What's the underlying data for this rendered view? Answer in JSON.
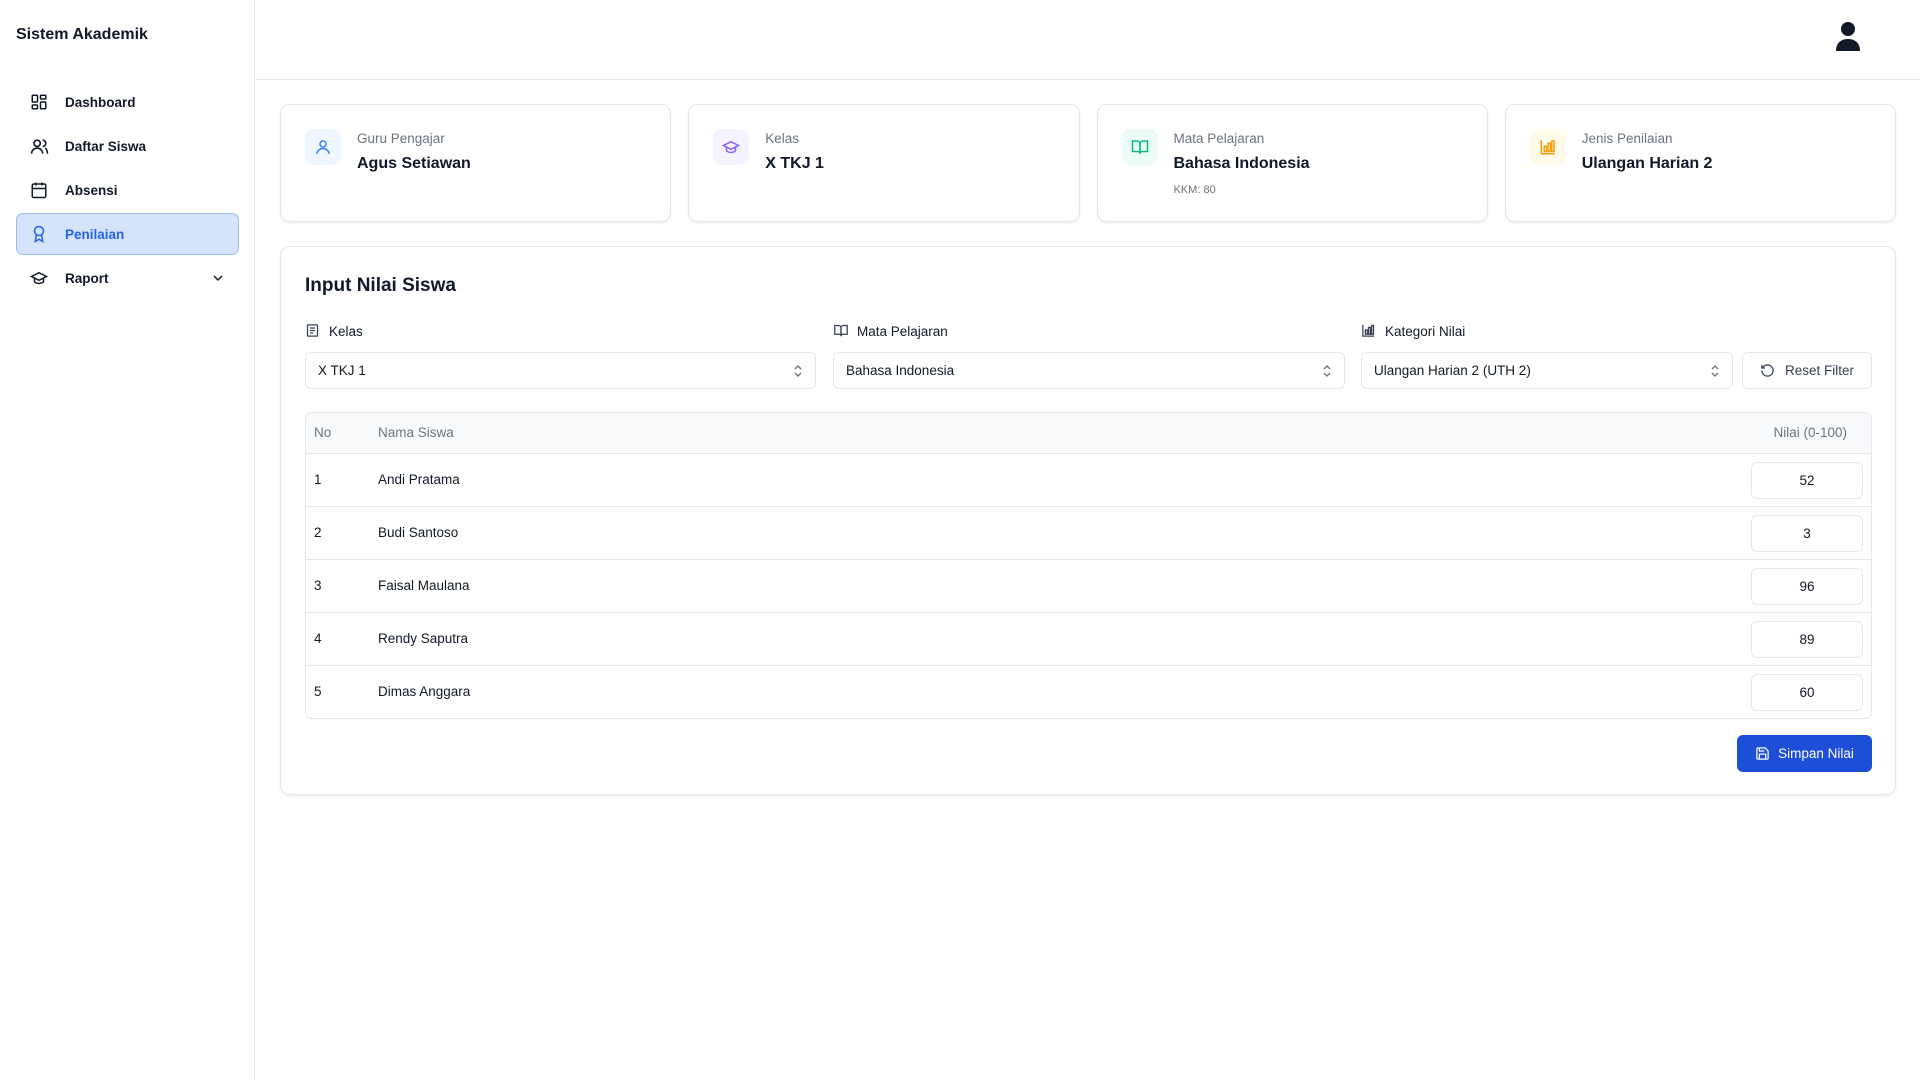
{
  "app": {
    "title": "Sistem Akademik"
  },
  "sidebar": {
    "items": [
      {
        "label": "Dashboard",
        "icon": "dashboard-grid-icon"
      },
      {
        "label": "Daftar Siswa",
        "icon": "users-icon"
      },
      {
        "label": "Absensi",
        "icon": "calendar-icon"
      },
      {
        "label": "Penilaian",
        "icon": "award-icon",
        "active": true
      },
      {
        "label": "Raport",
        "icon": "graduation-cap-icon",
        "expandable": true
      }
    ]
  },
  "cards": [
    {
      "label": "Guru Pengajar",
      "value": "Agus Setiawan",
      "icon": "user-icon",
      "color": "#3b82f6"
    },
    {
      "label": "Kelas",
      "value": "X TKJ 1",
      "icon": "graduation-cap-icon",
      "color": "#8b5cf6"
    },
    {
      "label": "Mata Pelajaran",
      "value": "Bahasa Indonesia",
      "sub": "KKM: 80",
      "icon": "book-open-icon",
      "color": "#10b981"
    },
    {
      "label": "Jenis Penilaian",
      "value": "Ulangan Harian 2",
      "icon": "bar-chart-icon",
      "color": "#f59e0b"
    }
  ],
  "panel": {
    "title": "Input Nilai Siswa",
    "filters": {
      "kelas": {
        "label": "Kelas",
        "value": "X TKJ 1"
      },
      "mapel": {
        "label": "Mata Pelajaran",
        "value": "Bahasa Indonesia"
      },
      "kategori": {
        "label": "Kategori Nilai",
        "value": "Ulangan Harian 2 (UTH 2)"
      },
      "reset_label": "Reset Filter"
    },
    "table": {
      "headers": {
        "no": "No",
        "name": "Nama Siswa",
        "score": "Nilai (0-100)"
      },
      "rows": [
        {
          "no": "1",
          "name": "Andi Pratama",
          "score": "52"
        },
        {
          "no": "2",
          "name": "Budi Santoso",
          "score": "3"
        },
        {
          "no": "3",
          "name": "Faisal Maulana",
          "score": "96"
        },
        {
          "no": "4",
          "name": "Rendy Saputra",
          "score": "89"
        },
        {
          "no": "5",
          "name": "Dimas Anggara",
          "score": "60"
        }
      ]
    },
    "save_label": "Simpan Nilai"
  },
  "colors": {
    "accent": "#1d4ed8",
    "active_bg": "#d6e4fb",
    "border": "#e5e7eb"
  }
}
